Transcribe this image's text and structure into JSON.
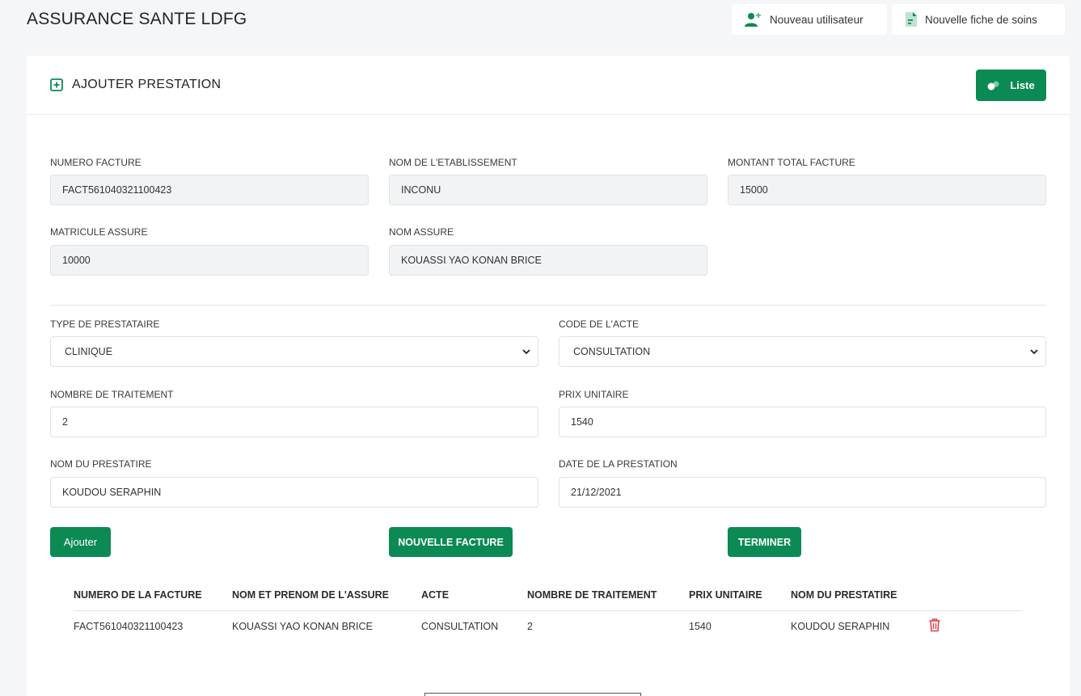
{
  "header": {
    "title": "ASSURANCE SANTE LDFG",
    "new_user_label": "Nouveau utilisateur",
    "new_sheet_label": "Nouvelle fiche de soins"
  },
  "card": {
    "title": "AJOUTER PRESTATION",
    "list_label": "Liste"
  },
  "invoice": {
    "numero_label": "NUMERO FACTURE",
    "numero_value": "FACT561040321100423",
    "etab_label": "NOM DE L'ETABLISSEMENT",
    "etab_value": "INCONU",
    "montant_label": "MONTANT TOTAL FACTURE",
    "montant_value": "15000",
    "matricule_label": "MATRICULE ASSURE",
    "matricule_value": "10000",
    "nom_label": "NOM ASSURE",
    "nom_value": "KOUASSI YAO KONAN BRICE"
  },
  "prestation": {
    "type_label": "TYPE DE PRESTATAIRE",
    "type_value": "CLINIQUE",
    "code_label": "CODE DE L'ACTE",
    "code_value": "CONSULTATION",
    "nombre_label": "NOMBRE DE TRAITEMENT",
    "nombre_value": "2",
    "prix_label": "PRIX UNITAIRE",
    "prix_value": "1540",
    "prestataire_label": "NOM DU PRESTATIRE",
    "prestataire_value": "KOUDOU SERAPHIN",
    "date_label": "DATE DE LA PRESTATION",
    "date_value": "21/12/2021"
  },
  "actions": {
    "add_label": "Ajouter",
    "new_invoice_label": "NOUVELLE FACTURE",
    "finish_label": "TERMINER"
  },
  "table": {
    "headers": [
      "NUMERO DE LA FACTURE",
      "NOM ET PRENOM DE L'ASSURE",
      "ACTE",
      "NOMBRE DE TRAITEMENT",
      "PRIX UNITAIRE",
      "NOM DU PRESTATIRE"
    ],
    "rows": [
      [
        "FACT561040321100423",
        "KOUASSI YAO KONAN BRICE",
        "CONSULTATION",
        "2",
        "1540",
        "KOUDOU SERAPHIN"
      ]
    ]
  },
  "colors": {
    "accent": "#0c8a54",
    "danger": "#e0454f",
    "background": "#f5f6f8"
  },
  "icons": {
    "new_user": "user-plus-icon",
    "new_sheet": "document-icon",
    "card_title": "plus-square-icon",
    "list": "toggle-icon",
    "delete": "trash-icon"
  }
}
